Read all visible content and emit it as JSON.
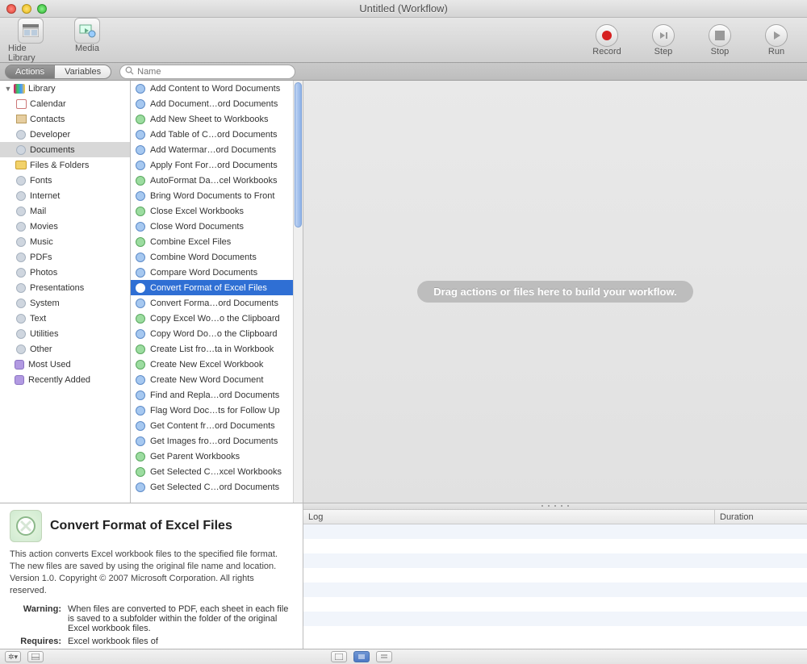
{
  "window": {
    "title": "Untitled (Workflow)"
  },
  "toolbar": {
    "hide_library": "Hide Library",
    "media": "Media",
    "record": "Record",
    "step": "Step",
    "stop": "Stop",
    "run": "Run"
  },
  "tabs": {
    "actions": "Actions",
    "variables": "Variables"
  },
  "search": {
    "placeholder": "Name"
  },
  "library": {
    "root": "Library",
    "items": [
      "Calendar",
      "Contacts",
      "Developer",
      "Documents",
      "Files & Folders",
      "Fonts",
      "Internet",
      "Mail",
      "Movies",
      "Music",
      "PDFs",
      "Photos",
      "Presentations",
      "System",
      "Text",
      "Utilities",
      "Other"
    ],
    "selected_index": 3,
    "most_used": "Most Used",
    "recently_added": "Recently Added"
  },
  "actions": {
    "selected_index": 13,
    "items": [
      {
        "label": "Add Content to Word Documents",
        "app": "word"
      },
      {
        "label": "Add Document…ord Documents",
        "app": "word"
      },
      {
        "label": "Add New Sheet to Workbooks",
        "app": "excel"
      },
      {
        "label": "Add Table of C…ord Documents",
        "app": "word"
      },
      {
        "label": "Add Watermar…ord Documents",
        "app": "word"
      },
      {
        "label": "Apply Font For…ord Documents",
        "app": "word"
      },
      {
        "label": "AutoFormat Da…cel Workbooks",
        "app": "excel"
      },
      {
        "label": "Bring Word Documents to Front",
        "app": "word"
      },
      {
        "label": "Close Excel Workbooks",
        "app": "excel"
      },
      {
        "label": "Close Word Documents",
        "app": "word"
      },
      {
        "label": "Combine Excel Files",
        "app": "excel"
      },
      {
        "label": "Combine Word Documents",
        "app": "word"
      },
      {
        "label": "Compare Word Documents",
        "app": "word"
      },
      {
        "label": "Convert Format of Excel Files",
        "app": "excel"
      },
      {
        "label": "Convert Forma…ord Documents",
        "app": "word"
      },
      {
        "label": "Copy Excel Wo…o the Clipboard",
        "app": "excel"
      },
      {
        "label": "Copy Word Do…o the Clipboard",
        "app": "word"
      },
      {
        "label": "Create List fro…ta in Workbook",
        "app": "excel"
      },
      {
        "label": "Create New Excel Workbook",
        "app": "excel"
      },
      {
        "label": "Create New Word Document",
        "app": "word"
      },
      {
        "label": "Find and Repla…ord Documents",
        "app": "word"
      },
      {
        "label": "Flag Word Doc…ts for Follow Up",
        "app": "word"
      },
      {
        "label": "Get Content fr…ord Documents",
        "app": "word"
      },
      {
        "label": "Get Images fro…ord Documents",
        "app": "word"
      },
      {
        "label": "Get Parent Workbooks",
        "app": "excel"
      },
      {
        "label": "Get Selected C…xcel Workbooks",
        "app": "excel"
      },
      {
        "label": "Get Selected C…ord Documents",
        "app": "word"
      }
    ]
  },
  "workflow": {
    "placeholder": "Drag actions or files here to build your workflow."
  },
  "info": {
    "title": "Convert Format of Excel Files",
    "description": "This action converts Excel workbook files to the specified file format. The new files are saved by using the original file name and location. Version 1.0. Copyright © 2007 Microsoft Corporation. All rights reserved.",
    "warning_label": "Warning:",
    "warning_text": "When files are converted to PDF, each sheet in each file is saved to a subfolder within the folder of the original Excel workbook files.",
    "requires_label": "Requires:",
    "requires_text": "Excel workbook files of"
  },
  "log": {
    "col1": "Log",
    "col2": "Duration"
  }
}
